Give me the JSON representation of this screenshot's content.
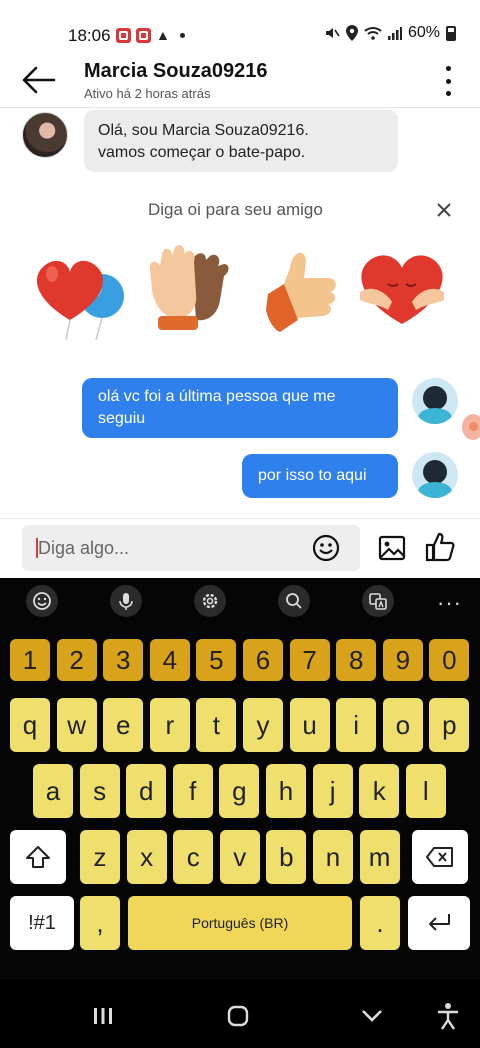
{
  "status_bar": {
    "time": "18:06",
    "battery": "60%"
  },
  "header": {
    "name": "Marcia Souza09216",
    "status": "Ativo há 2 horas atrás"
  },
  "messages": {
    "incoming_1": "Olá, sou Marcia Souza09216.\nvamos começar o bate-papo.",
    "outgoing_1": "olá vc foi a última pessoa que me seguiu",
    "outgoing_2": "por isso to aqui"
  },
  "greeting": {
    "prompt": "Diga oi para seu amigo",
    "stickers": [
      "heart-balloon-sticker",
      "high-five-sticker",
      "thumbs-up-sticker",
      "heart-hug-sticker"
    ]
  },
  "composer": {
    "placeholder": "Diga algo..."
  },
  "keyboard": {
    "numbers": [
      "1",
      "2",
      "3",
      "4",
      "5",
      "6",
      "7",
      "8",
      "9",
      "0"
    ],
    "row1": [
      "q",
      "w",
      "e",
      "r",
      "t",
      "y",
      "u",
      "i",
      "o",
      "p"
    ],
    "row2": [
      "a",
      "s",
      "d",
      "f",
      "g",
      "h",
      "j",
      "k",
      "l"
    ],
    "row3": [
      "z",
      "x",
      "c",
      "v",
      "b",
      "n",
      "m"
    ],
    "symbols_label": "!#1",
    "comma": ",",
    "space_label": "Português (BR)",
    "period": ".",
    "toolbar_more": "···"
  },
  "colors": {
    "accent_blue": "#2f80ed",
    "key_number": "#d9a21b",
    "key_letter": "#efe06e"
  }
}
